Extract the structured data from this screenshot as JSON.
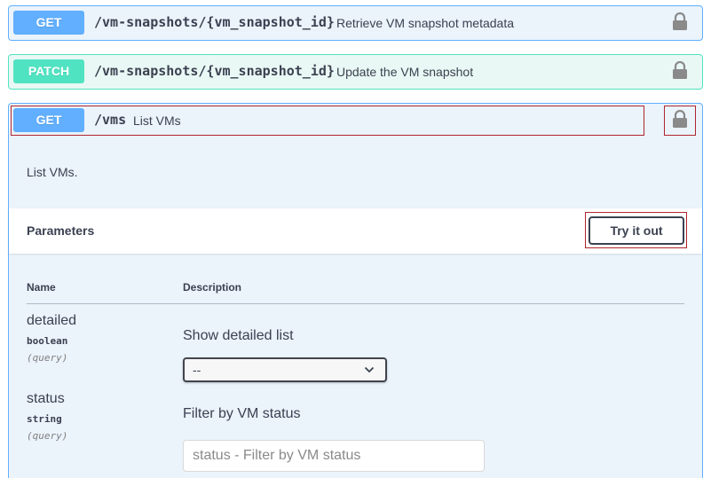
{
  "operations": [
    {
      "method": "GET",
      "path": "/vm-snapshots/{vm_snapshot_id}",
      "summary": "Retrieve VM snapshot metadata"
    },
    {
      "method": "PATCH",
      "path": "/vm-snapshots/{vm_snapshot_id}",
      "summary": "Update the VM snapshot"
    },
    {
      "method": "GET",
      "path": "/vms",
      "summary": "List VMs"
    }
  ],
  "expanded": {
    "description": "List VMs.",
    "parameters_title": "Parameters",
    "try_button": "Try it out",
    "columns": {
      "name": "Name",
      "description": "Description"
    },
    "params": [
      {
        "name": "detailed",
        "type": "boolean",
        "in": "(query)",
        "description": "Show detailed list",
        "select_value": "--"
      },
      {
        "name": "status",
        "type": "string",
        "in": "(query)",
        "description": "Filter by VM status",
        "placeholder": "status - Filter by VM status"
      }
    ]
  },
  "colors": {
    "get": "#61affe",
    "patch": "#50e3c2",
    "highlight": "#b0252d"
  },
  "icons": [
    "lock-icon",
    "chevron-down-icon"
  ]
}
